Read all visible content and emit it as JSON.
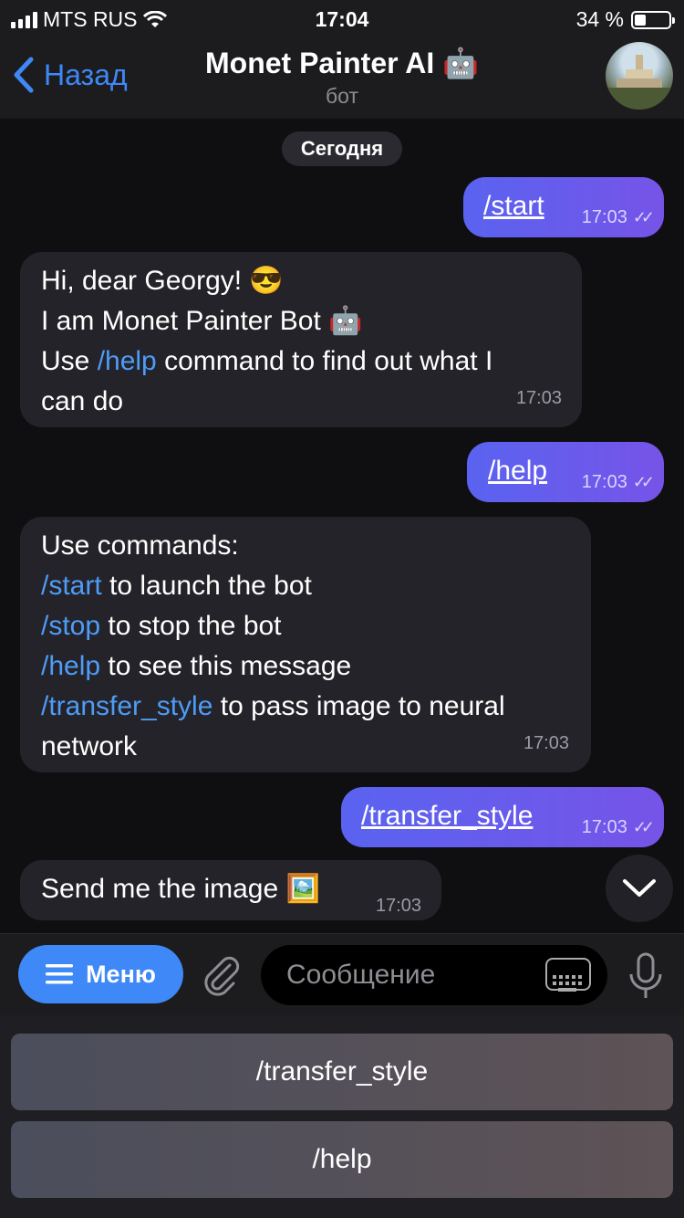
{
  "status_bar": {
    "carrier": "MTS RUS",
    "time": "17:04",
    "battery": "34 %",
    "battery_level": 0.34
  },
  "header": {
    "back_label": "Назад",
    "title": "Monet Painter AI 🤖",
    "subtitle": "бот"
  },
  "chat": {
    "date_label": "Сегодня",
    "messages": [
      {
        "dir": "out",
        "text": "/start",
        "time": "17:03"
      },
      {
        "dir": "in",
        "line1": "Hi, dear Georgy! 😎",
        "line2": "I am Monet Painter Bot 🤖",
        "line3_pre": "Use ",
        "line3_link": "/help",
        "line3_post": " command to find out what I",
        "line4": "can do",
        "time": "17:03"
      },
      {
        "dir": "out",
        "text": "/help",
        "time": "17:03"
      },
      {
        "dir": "in",
        "intro": "Use commands:",
        "cmd1": "/start",
        "desc1": " to launch the bot",
        "cmd2": "/stop",
        "desc2": " to stop the bot",
        "cmd3": "/help",
        "desc3": " to see this message",
        "cmd4": "/transfer_style",
        "desc4": " to pass image to neural",
        "tail": "network",
        "time": "17:03"
      },
      {
        "dir": "out",
        "text": "/transfer_style",
        "time": "17:03"
      },
      {
        "dir": "in",
        "text": "Send me the image 🖼️",
        "time": "17:03"
      }
    ]
  },
  "input": {
    "menu_label": "Меню",
    "placeholder": "Сообщение"
  },
  "keyboard": {
    "buttons": [
      "/transfer_style",
      "/help"
    ]
  },
  "colors": {
    "accent": "#3e88f7",
    "outgoing_start": "#5a63f0",
    "outgoing_end": "#7654e8",
    "incoming": "#242329"
  }
}
